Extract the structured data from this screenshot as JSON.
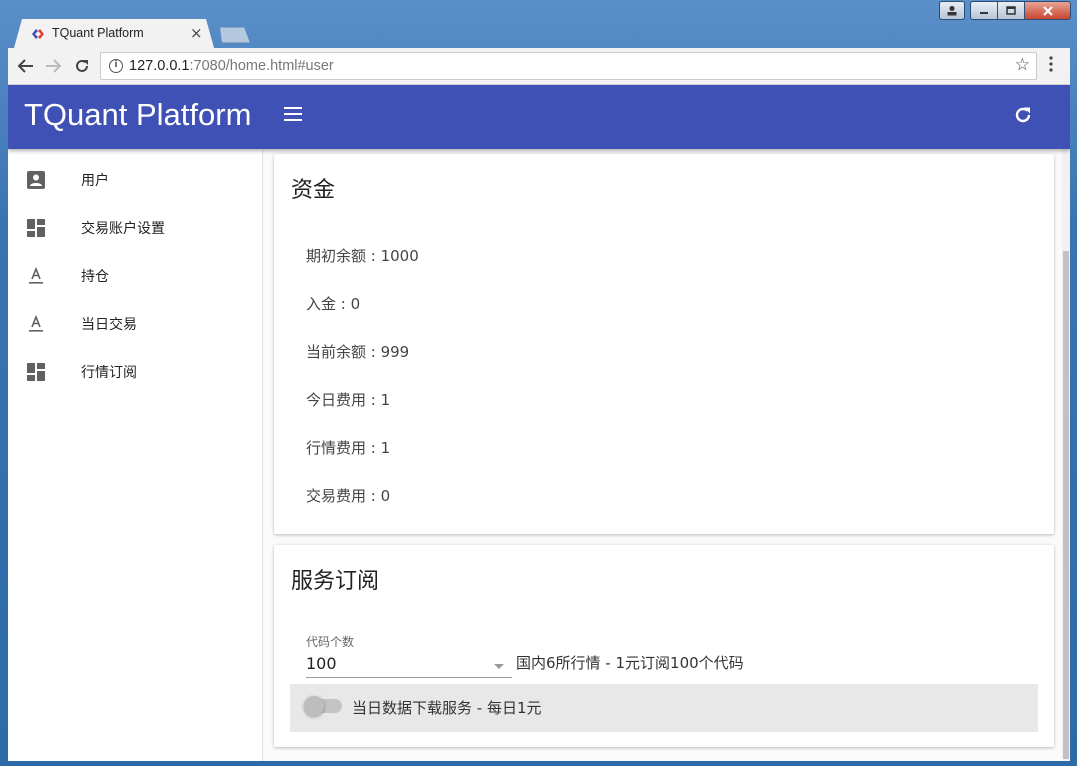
{
  "browser": {
    "tab_title": "TQuant Platform",
    "tab_close": "×",
    "url_host": "127.0.0.1",
    "url_rest": ":7080/home.html#user",
    "icons": [
      "back-arrow-icon",
      "forward-arrow-icon",
      "reload-icon",
      "info-icon",
      "star-icon",
      "menu-dots-icon"
    ]
  },
  "appbar": {
    "brand": "TQuant Platform",
    "color": "#3f51b5"
  },
  "sidebar": {
    "items": [
      {
        "label": "用户",
        "icon": "account-box-icon"
      },
      {
        "label": "交易账户设置",
        "icon": "dashboard-icon"
      },
      {
        "label": "持仓",
        "icon": "text-format-icon"
      },
      {
        "label": "当日交易",
        "icon": "text-format-icon"
      },
      {
        "label": "行情订阅",
        "icon": "dashboard-icon"
      }
    ]
  },
  "funds": {
    "title": "资金",
    "rows": [
      "期初余额 : 1000",
      "入金 : 0",
      "当前余额 : 999",
      "今日费用 : 1",
      "行情费用 : 1",
      "交易费用 : 0"
    ]
  },
  "subscription": {
    "title": "服务订阅",
    "code_count_label": "代码个数",
    "code_count_value": "100",
    "code_count_desc": "国内6所行情 - 1元订阅100个代码",
    "daily_download_label": "当日数据下载服务 - 每日1元",
    "daily_download_enabled": false
  }
}
